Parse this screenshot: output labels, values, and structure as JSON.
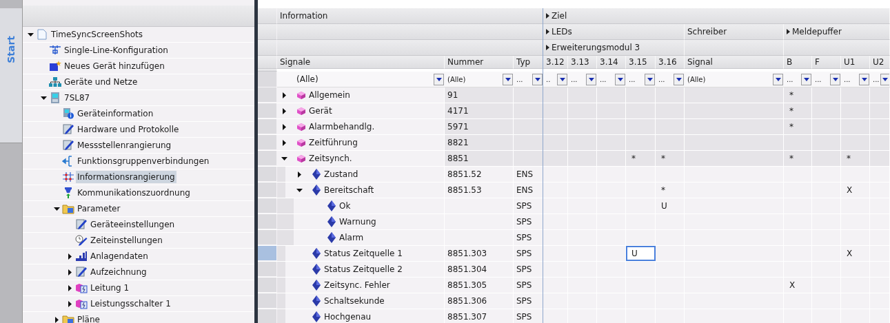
{
  "side_tab": {
    "label": "Start"
  },
  "project_tree": [
    {
      "label": "TimeSyncScreenShots",
      "kind": "project",
      "expanded": true,
      "selected": false,
      "children": [
        {
          "label": "Single-Line-Konfiguration",
          "kind": "single-line",
          "selected": false
        },
        {
          "label": "Neues Gerät hinzufügen",
          "kind": "add-device",
          "selected": false
        },
        {
          "label": "Geräte und Netze",
          "kind": "network",
          "selected": false
        },
        {
          "label": "7SL87",
          "kind": "device",
          "expanded": true,
          "selected": false,
          "children": [
            {
              "label": "Geräteinformation",
              "kind": "device-info",
              "selected": false
            },
            {
              "label": "Hardware und Protokolle",
              "kind": "editor",
              "selected": false
            },
            {
              "label": "Messstellenrangierung",
              "kind": "editor",
              "selected": false
            },
            {
              "label": "Funktionsgruppenverbindungen",
              "kind": "connections",
              "selected": false
            },
            {
              "label": "Informationsrangierung",
              "kind": "routing",
              "selected": true
            },
            {
              "label": "Kommunikationszuordnung",
              "kind": "communication",
              "selected": false
            },
            {
              "label": "Parameter",
              "kind": "folder",
              "expanded": true,
              "selected": false,
              "children": [
                {
                  "label": "Geräteeinstellungen",
                  "kind": "editor",
                  "selected": false
                },
                {
                  "label": "Zeiteinstellungen",
                  "kind": "time",
                  "selected": false
                },
                {
                  "label": "Anlagendaten",
                  "kind": "plant",
                  "expanded": false,
                  "selected": false
                },
                {
                  "label": "Aufzeichnung",
                  "kind": "editor",
                  "expanded": false,
                  "selected": false
                },
                {
                  "label": "Leitung 1",
                  "kind": "function",
                  "expanded": false,
                  "selected": false
                },
                {
                  "label": "Leistungsschalter 1",
                  "kind": "function",
                  "expanded": false,
                  "selected": false
                }
              ]
            },
            {
              "label": "Pläne",
              "kind": "folder",
              "expanded": false,
              "selected": false
            }
          ]
        }
      ]
    }
  ],
  "table": {
    "header_groups": {
      "information": {
        "label": "Information",
        "expandable": false
      },
      "target": {
        "label": "Ziel",
        "expandable": true
      },
      "leds": {
        "label": "LEDs",
        "expandable": true
      },
      "recorder": {
        "label": "Schreiber",
        "expandable": false
      },
      "buffer": {
        "label": "Meldepuffer",
        "expandable": true
      },
      "expansion_module": {
        "label": "Erweiterungsmodul 3",
        "expandable": true
      }
    },
    "columns": [
      "Signale",
      "Nummer",
      "Typ",
      "3.12",
      "3.13",
      "3.14",
      "3.15",
      "3.16",
      "Signal",
      "B",
      "F",
      "U1",
      "U2"
    ],
    "filters": [
      "(Alle)",
      "(Alle)",
      "...",
      "..",
      "...",
      "...",
      "...",
      "...",
      "(Alle)",
      "...",
      "...",
      "...",
      "..."
    ],
    "rows": [
      {
        "signal": "Allgemein",
        "kind": "group",
        "expanded": false,
        "selected": false,
        "number": "91",
        "targets": {
          "buffer_b": "*"
        }
      },
      {
        "signal": "Gerät",
        "kind": "group",
        "expanded": false,
        "selected": false,
        "number": "4171",
        "targets": {
          "buffer_b": "*"
        }
      },
      {
        "signal": "Alarmbehandlg.",
        "kind": "group",
        "expanded": false,
        "selected": false,
        "number": "5971",
        "targets": {
          "buffer_b": "*"
        }
      },
      {
        "signal": "Zeitführung",
        "kind": "group",
        "expanded": false,
        "selected": false,
        "number": "8821"
      },
      {
        "signal": "Zeitsynch.",
        "kind": "group",
        "expanded": true,
        "selected": false,
        "number": "8851",
        "targets": {
          "led_3_15": "*",
          "led_3_16": "*",
          "buffer_b": "*",
          "buffer_u1": "*"
        },
        "children": [
          {
            "signal": "Zustand",
            "kind": "signal",
            "expanded": false,
            "selected": false,
            "number": "8851.52",
            "type": "ENS"
          },
          {
            "signal": "Bereitschaft",
            "kind": "signal",
            "expanded": true,
            "selected": false,
            "number": "8851.53",
            "type": "ENS",
            "targets": {
              "led_3_16": "*",
              "buffer_u1": "X"
            },
            "children": [
              {
                "signal": "Ok",
                "kind": "signal",
                "selected": false,
                "type": "SPS",
                "targets": {
                  "led_3_16": "U"
                }
              },
              {
                "signal": "Warnung",
                "kind": "signal",
                "selected": false,
                "type": "SPS"
              },
              {
                "signal": "Alarm",
                "kind": "signal",
                "selected": false,
                "type": "SPS"
              }
            ]
          },
          {
            "signal": "Status Zeitquelle 1",
            "kind": "signal",
            "selected": true,
            "number": "8851.303",
            "type": "SPS",
            "targets": {
              "led_3_15": {
                "text": "U",
                "focused": true
              },
              "buffer_u1": "X"
            }
          },
          {
            "signal": "Status Zeitquelle 2",
            "kind": "signal",
            "selected": false,
            "number": "8851.304",
            "type": "SPS"
          },
          {
            "signal": "Zeitsync. Fehler",
            "kind": "signal",
            "selected": false,
            "number": "8851.305",
            "type": "SPS",
            "targets": {
              "buffer_b": "X"
            }
          },
          {
            "signal": "Schaltsekunde",
            "kind": "signal",
            "selected": false,
            "number": "8851.306",
            "type": "SPS"
          },
          {
            "signal": "Hochgenau",
            "kind": "signal",
            "selected": false,
            "number": "8851.307",
            "type": "SPS"
          }
        ]
      }
    ]
  }
}
